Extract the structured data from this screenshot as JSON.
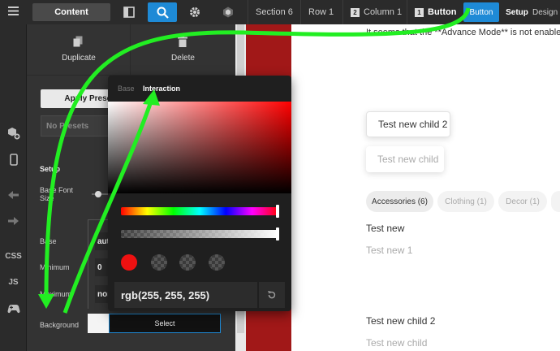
{
  "topbar": {
    "content_label": "Content",
    "breadcrumbs": [
      "Section 6",
      "Row 1",
      "2",
      "Column 1",
      "1",
      "Button"
    ],
    "active_label": "Button",
    "setup_label": "Setup",
    "design_label": "Design"
  },
  "rail": {
    "css_label": "CSS",
    "js_label": "JS"
  },
  "panel": {
    "duplicate_label": "Duplicate",
    "delete_label": "Delete",
    "apply_label": "Apply Preset",
    "presets_placeholder": "No Presets",
    "setup_heading": "Setup",
    "base_font_label_1": "Base Font",
    "base_font_label_2": "Size",
    "base_label": "Base",
    "base_value": "aut",
    "minimum_label": "Minimum",
    "minimum_value": "0",
    "maximum_label": "Maximum",
    "maximum_value": "nor",
    "background_label": "Background",
    "select_label": "Select"
  },
  "picker": {
    "tab_base": "Base",
    "tab_interaction": "Interaction",
    "value": "rgb(255, 255, 255)"
  },
  "canvas": {
    "notice": "It seems that the **Advance Mode** is not enabled",
    "card1": "Test new child 2",
    "card2": "Test new child",
    "pills": [
      "Accessories (6)",
      "Clothing (1)",
      "Decor (1)"
    ],
    "text1": "Test new",
    "text2": "Test new 1",
    "text3": "Test new child 2",
    "text4": "Test new child"
  },
  "colors": {
    "accent": "#1e8ad6",
    "annotation": "#22ee22",
    "red_band": "#a11818",
    "panel": "#333333"
  }
}
